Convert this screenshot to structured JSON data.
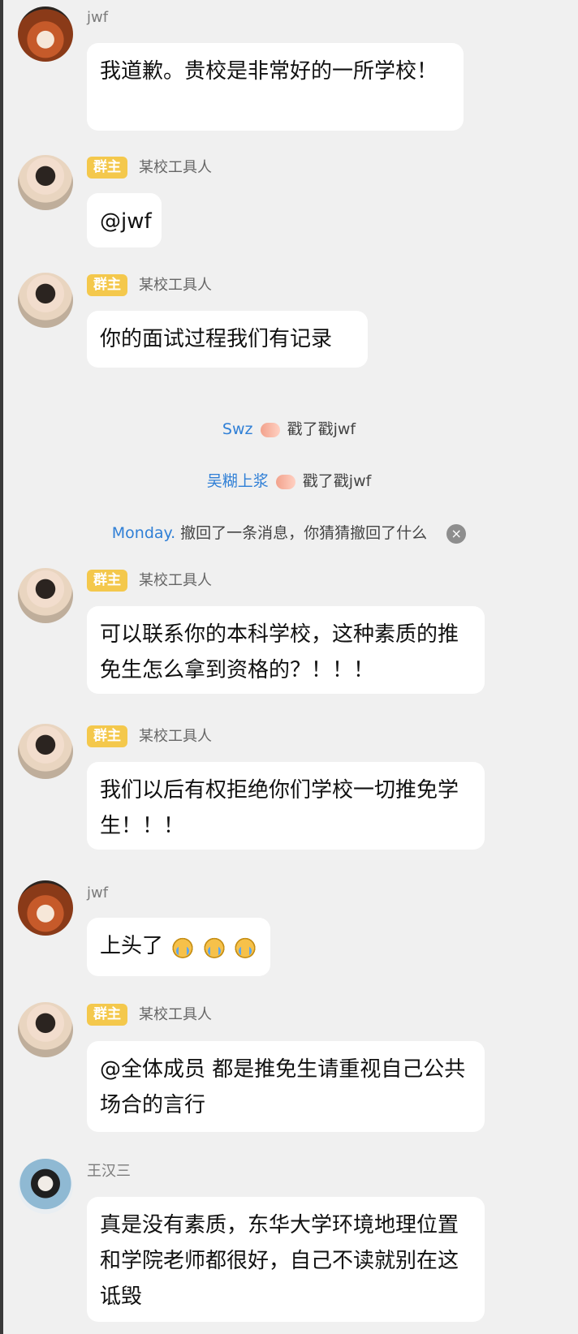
{
  "messages": [
    {
      "sender": "jwf",
      "role": "",
      "text": "我道歉。贵校是非常好的一所学校！"
    },
    {
      "sender": "某校工具人",
      "role": "群主",
      "text": "@jwf"
    },
    {
      "sender": "某校工具人",
      "role": "群主",
      "text": "你的面试过程我们有记录"
    }
  ],
  "system": {
    "poke1": {
      "actor": "Swz",
      "action": "戳了戳jwf"
    },
    "poke2": {
      "actor": "吴糊上浆",
      "action": "戳了戳jwf"
    },
    "recall": {
      "actor": "Monday.",
      "action": "撤回了一条消息，你猜猜撤回了什么",
      "close_icon": "close-circle-icon"
    }
  },
  "messages2": [
    {
      "sender": "某校工具人",
      "role": "群主",
      "text": "可以联系你的本科学校，这种素质的推免生怎么拿到资格的？！！！"
    },
    {
      "sender": "某校工具人",
      "role": "群主",
      "text": "我们以后有权拒绝你们学校一切推免学生！！！"
    },
    {
      "sender": "jwf",
      "role": "",
      "text": "上头了",
      "emoji": [
        "crying-face-icon",
        "crying-face-icon",
        "crying-face-icon"
      ]
    },
    {
      "sender": "某校工具人",
      "role": "群主",
      "text": "@全体成员 都是推免生请重视自己公共场合的言行"
    },
    {
      "sender": "王汉三",
      "role": "",
      "text": "真是没有素质，东华大学环境地理位置和学院老师都很好，自己不读就别在这诋毁"
    }
  ],
  "colors": {
    "background": "#f0f0f0",
    "bubble": "#ffffff",
    "badge": "#f4c84c",
    "link": "#2f7fd6"
  }
}
